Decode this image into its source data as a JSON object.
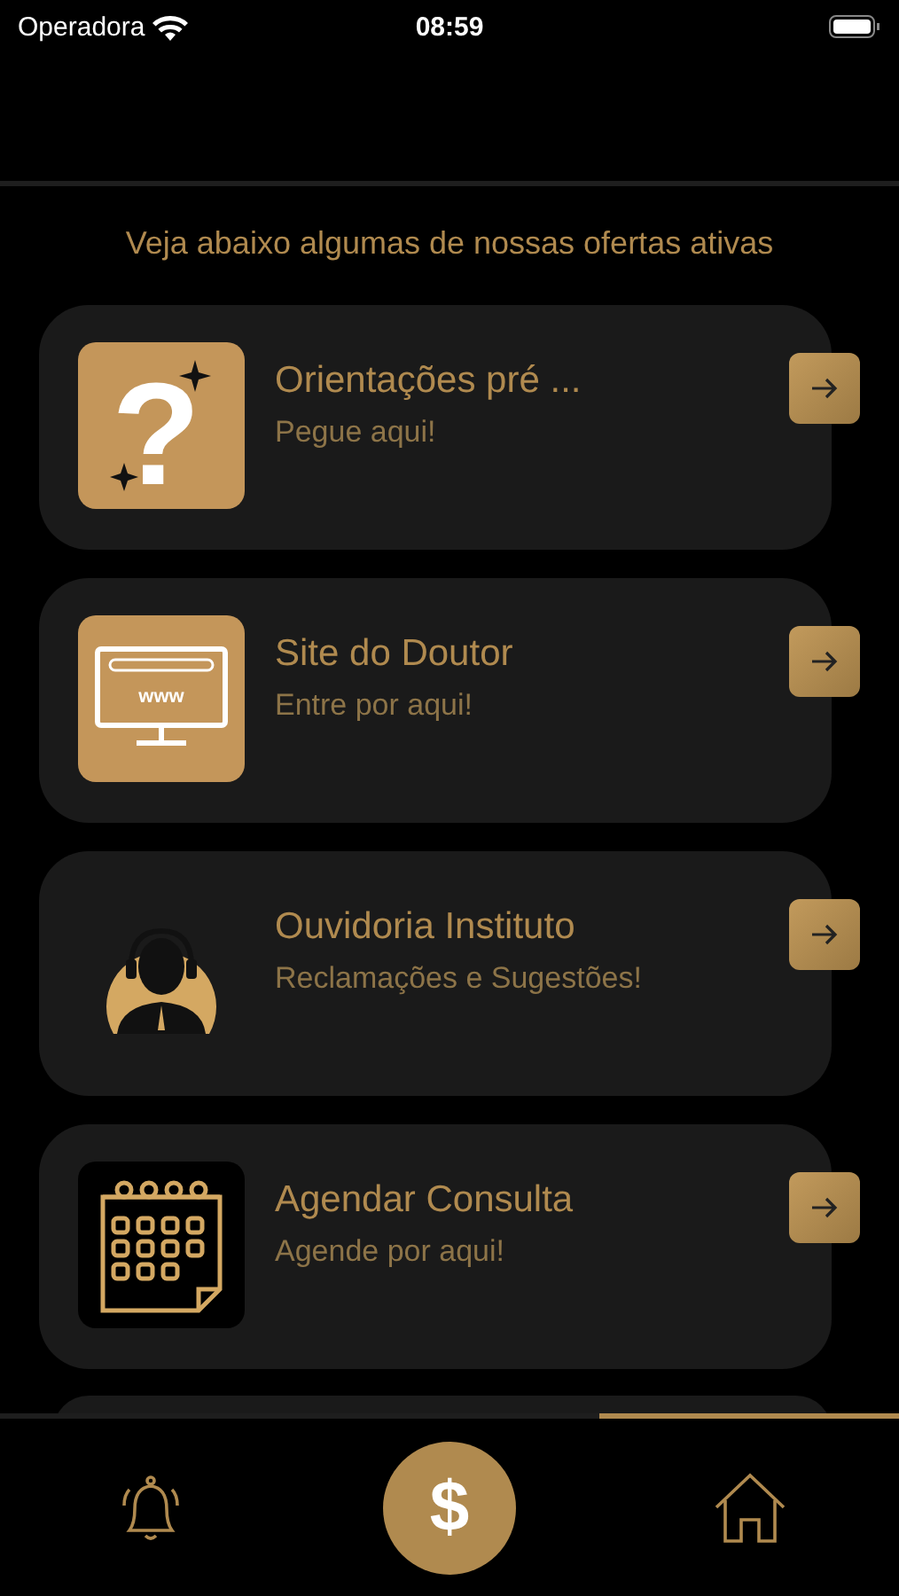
{
  "status_bar": {
    "carrier": "Operadora",
    "time": "08:59"
  },
  "subtitle": "Veja abaixo algumas de nossas ofertas ativas",
  "offers": [
    {
      "kind": "question",
      "title": "Orientações pré ...",
      "subtitle": "Pegue aqui!",
      "icon_text": "?"
    },
    {
      "kind": "web",
      "title": "Site do Doutor",
      "subtitle": "Entre por aqui!",
      "icon_text": "www"
    },
    {
      "kind": "headset",
      "title": "Ouvidoria Instituto",
      "subtitle": "Reclamações e Sugestões!"
    },
    {
      "kind": "calendar",
      "title": "Agendar Consulta",
      "subtitle": "Agende por aqui!"
    }
  ],
  "tabs": [
    {
      "kind": "bell",
      "selected": false
    },
    {
      "kind": "money",
      "selected": false,
      "symbol": "$"
    },
    {
      "kind": "home",
      "selected": true
    }
  ]
}
